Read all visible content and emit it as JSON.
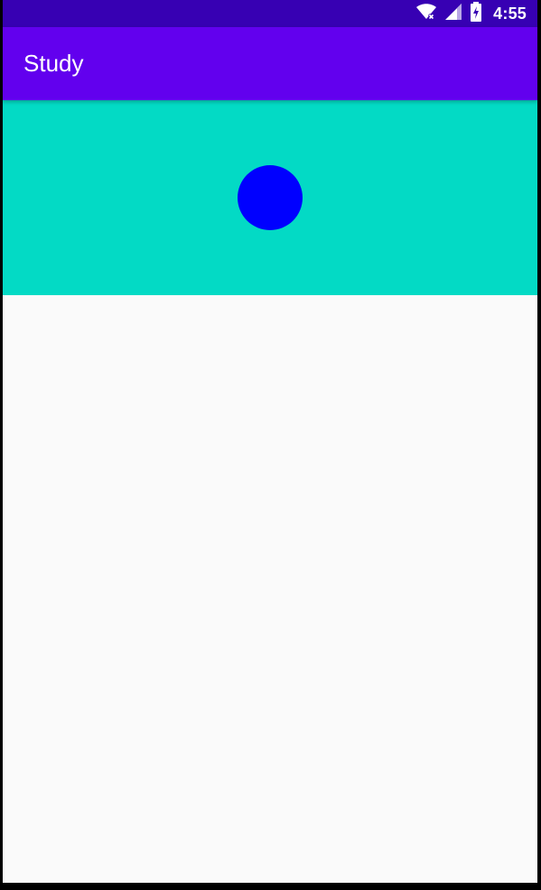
{
  "status_bar": {
    "time": "4:55",
    "icons": [
      "wifi-icon",
      "cellular-signal-icon",
      "battery-charging-icon"
    ]
  },
  "app_bar": {
    "title": "Study"
  },
  "colors": {
    "status_bar": "#3700b3",
    "app_bar": "#6200ee",
    "header_panel": "#03dac5",
    "circle": "#0000ff",
    "background": "#fafafa"
  }
}
